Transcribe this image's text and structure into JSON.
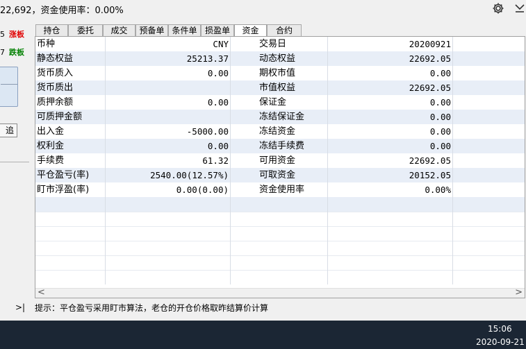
{
  "topbar": {
    "summary": "22,692，资金使用率：0.00%",
    "settings_icon": "gear-icon",
    "collapse_icon": "chevron-down-icon"
  },
  "left_panel": {
    "rows": [
      {
        "num": "5",
        "tag": "涨板",
        "kind": "up"
      },
      {
        "num": "7",
        "tag": "跌板",
        "kind": "down"
      }
    ],
    "button_label": "追",
    "arrow": ">|"
  },
  "tabs": [
    {
      "label": "持仓",
      "active": false
    },
    {
      "label": "委托",
      "active": false
    },
    {
      "label": "成交",
      "active": false
    },
    {
      "label": "预备单",
      "active": false
    },
    {
      "label": "条件单",
      "active": false
    },
    {
      "label": "损盈单",
      "active": false
    },
    {
      "label": "资金",
      "active": true
    },
    {
      "label": "合约",
      "active": false
    }
  ],
  "fund_rows": [
    {
      "l1": "币种",
      "v1": "CNY",
      "l2": "交易日",
      "v2": "20200921"
    },
    {
      "l1": "静态权益",
      "v1": "25213.37",
      "l2": "动态权益",
      "v2": "22692.05"
    },
    {
      "l1": "货币质入",
      "v1": "0.00",
      "l2": "期权市值",
      "v2": "0.00"
    },
    {
      "l1": "货币质出",
      "v1": "",
      "l2": "市值权益",
      "v2": "22692.05"
    },
    {
      "l1": "质押余额",
      "v1": "0.00",
      "l2": "保证金",
      "v2": "0.00"
    },
    {
      "l1": "可质押金额",
      "v1": "",
      "l2": "冻结保证金",
      "v2": "0.00"
    },
    {
      "l1": "出入金",
      "v1": "-5000.00",
      "l2": "冻结资金",
      "v2": "0.00"
    },
    {
      "l1": "权利金",
      "v1": "0.00",
      "l2": "冻结手续费",
      "v2": "0.00"
    },
    {
      "l1": "手续费",
      "v1": "61.32",
      "l2": "可用资金",
      "v2": "22692.05"
    },
    {
      "l1": "平仓盈亏(率)",
      "v1": "2540.00(12.57%)",
      "l2": "可取资金",
      "v2": "20152.05"
    },
    {
      "l1": "盯市浮盈(率)",
      "v1": "0.00(0.00)",
      "l2": "资金使用率",
      "v2": "0.00%"
    }
  ],
  "scroll": {
    "left": "<",
    "right": ">"
  },
  "hint": "提示：平仓盈亏采用盯市算法，老仓的开仓价格取昨结算价计算",
  "taskbar": {
    "time": "15:06",
    "date": "2020-09-21"
  },
  "colors": {
    "up": "#e00000",
    "down": "#008000",
    "row_shade": "#e8eef7",
    "taskbar": "#1b2634"
  }
}
